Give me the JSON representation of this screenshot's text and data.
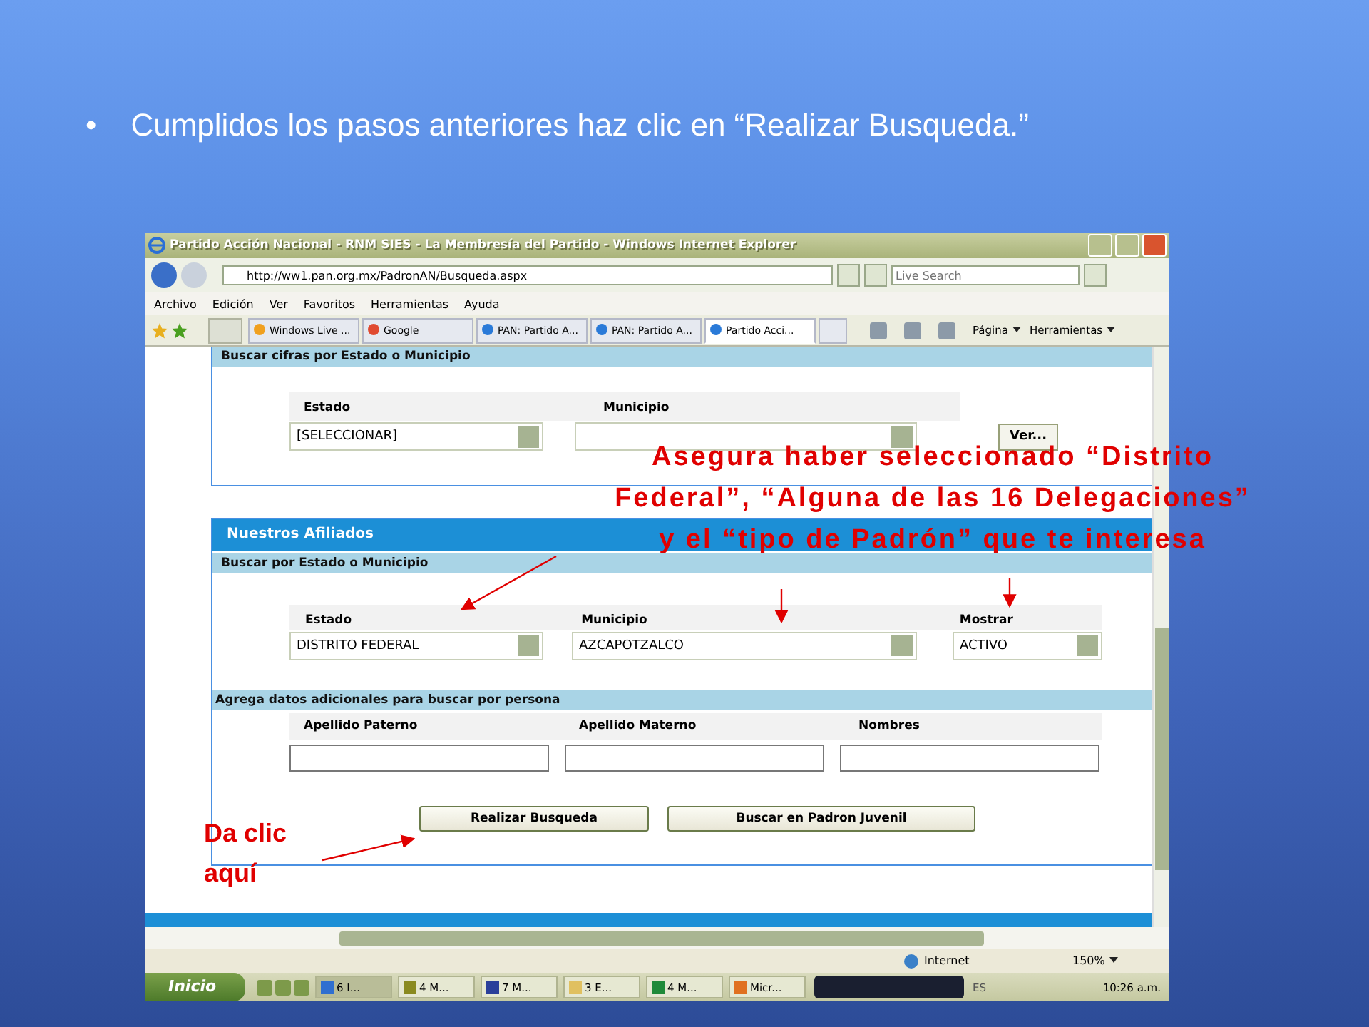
{
  "slide": {
    "bullet": "•",
    "text": "Cumplidos los pasos anteriores haz clic en “Realizar Busqueda.”"
  },
  "window": {
    "title": "Partido Acción Nacional - RNM SIES - La Membresía del Partido - Windows Internet Explorer",
    "address": "http://ww1.pan.org.mx/PadronAN/Busqueda.aspx",
    "search_placeholder": "Live Search"
  },
  "menu": [
    "Archivo",
    "Edición",
    "Ver",
    "Favoritos",
    "Herramientas",
    "Ayuda"
  ],
  "tabs": [
    {
      "label": "Windows Live ...",
      "selected": false,
      "kind": "live"
    },
    {
      "label": "Google",
      "selected": false,
      "kind": "google"
    },
    {
      "label": "PAN: Partido A...",
      "selected": false,
      "kind": "ie"
    },
    {
      "label": "PAN: Partido A...",
      "selected": false,
      "kind": "ie"
    },
    {
      "label": "Partido Acci...",
      "selected": true,
      "kind": "ie"
    }
  ],
  "toolbar": [
    "Página",
    "Herramientas"
  ],
  "panel_top": {
    "title": "Buscar cifras por Estado o Municipio",
    "fields": [
      {
        "label": "Estado",
        "value": "[SELECCIONAR]"
      },
      {
        "label": "Municipio"
      }
    ],
    "button": "Ver..."
  },
  "panel_afiliados": {
    "title": "Nuestros Afiliados",
    "subtitle": "Buscar por Estado o Municipio",
    "selects": [
      {
        "label": "Estado",
        "value": "DISTRITO FEDERAL"
      },
      {
        "label": "Municipio",
        "value": "AZCAPOTZALCO"
      },
      {
        "label": "Mostrar",
        "value": "ACTIVO"
      }
    ],
    "person_heading": "Agrega datos adicionales para buscar por persona",
    "inputs": [
      "Apellido Paterno",
      "Apellido Materno",
      "Nombres"
    ],
    "buttons": [
      "Realizar Busqueda",
      "Buscar en Padron Juvenil"
    ]
  },
  "status_bar": {
    "zone": "Internet",
    "zoom": "150%"
  },
  "taskbar": {
    "start": "Inicio",
    "items": [
      {
        "label": "6 I...",
        "selected": true,
        "color": "#2f6fd0"
      },
      {
        "label": "4 M...",
        "selected": false,
        "color": "#8a8a20"
      },
      {
        "label": "7 M...",
        "selected": false,
        "color": "#2a3f9a"
      },
      {
        "label": "3 E...",
        "selected": false,
        "color": "#e0c060"
      },
      {
        "label": "4 M...",
        "selected": false,
        "color": "#1f8a3a"
      },
      {
        "label": "Micr...",
        "selected": false,
        "color": "#e07020"
      }
    ],
    "lang": "ES",
    "clock": "10:26 a.m."
  },
  "annotations": {
    "note": "Asegura haber seleccionado “Distrito Federal”, “Alguna de las 16 Delegaciones” y el “tipo de Padrón” que te interesa",
    "hint": "Da clic aquí"
  }
}
